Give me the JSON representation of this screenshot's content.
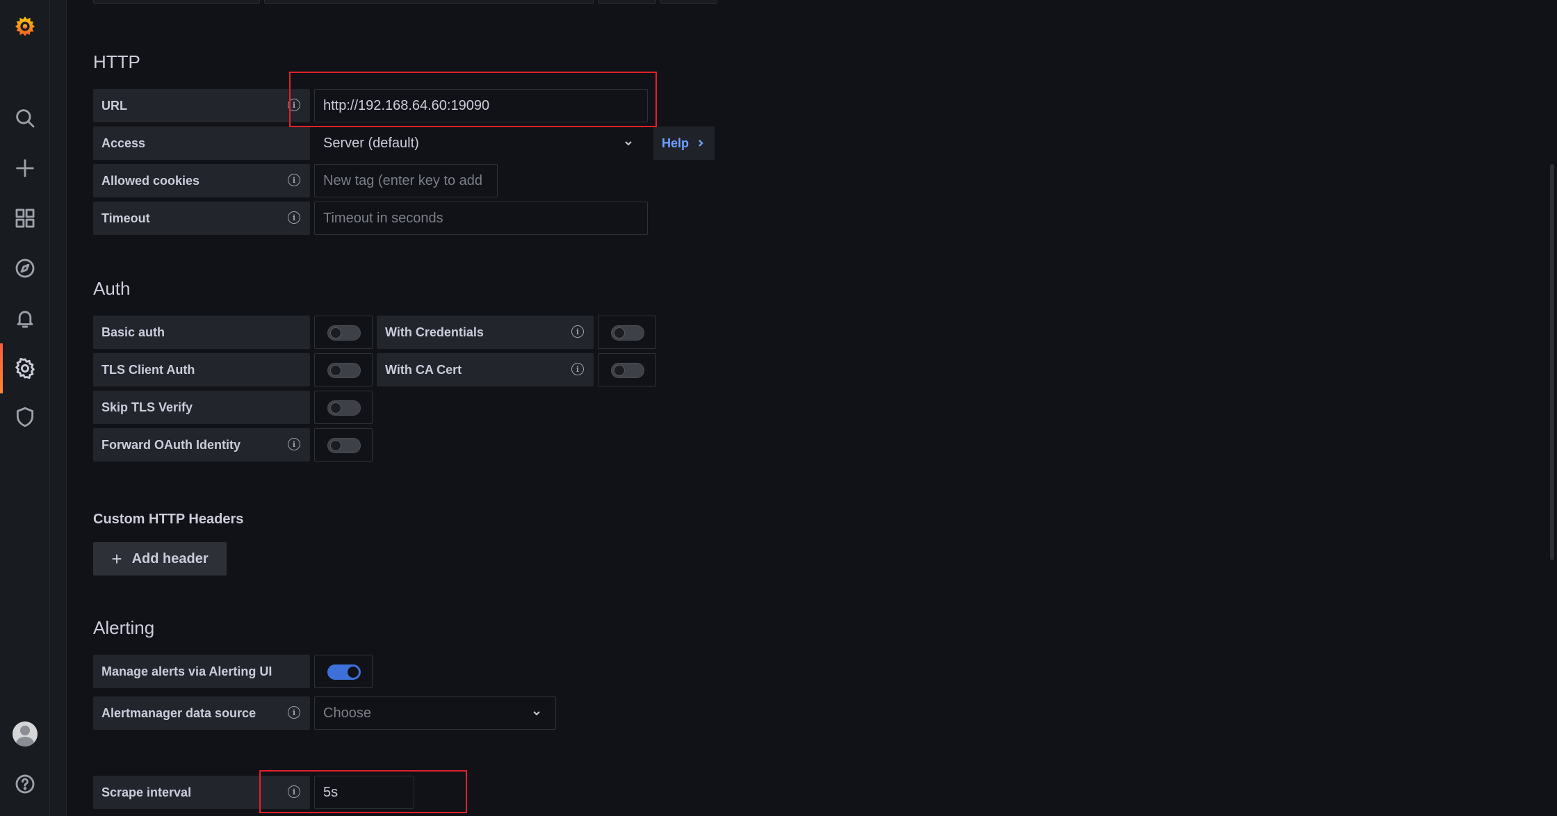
{
  "colors": {
    "accent": "#3d71d9",
    "brand": "#f55f3e",
    "link": "#6e9fff",
    "annotation": "#e3202a"
  },
  "sidebar": {
    "icons": [
      "grafana-logo-icon",
      "search-icon",
      "plus-icon",
      "dashboards-icon",
      "explore-icon",
      "alerting-icon",
      "gear-icon",
      "shield-icon",
      "avatar",
      "help-icon"
    ],
    "active": "gear-icon"
  },
  "http": {
    "title": "HTTP",
    "url_label": "URL",
    "url_value": "http://192.168.64.60:19090",
    "access_label": "Access",
    "access_value": "Server (default)",
    "help_label": "Help",
    "cookies_label": "Allowed cookies",
    "cookies_placeholder": "New tag (enter key to add",
    "timeout_label": "Timeout",
    "timeout_placeholder": "Timeout in seconds"
  },
  "auth": {
    "title": "Auth",
    "basic_auth": "Basic auth",
    "with_credentials": "With Credentials",
    "tls_client_auth": "TLS Client Auth",
    "with_ca_cert": "With CA Cert",
    "skip_tls_verify": "Skip TLS Verify",
    "forward_oauth": "Forward OAuth Identity"
  },
  "headers": {
    "title": "Custom HTTP Headers",
    "add_button": "Add header"
  },
  "alerting": {
    "title": "Alerting",
    "manage_alerts_label": "Manage alerts via Alerting UI",
    "manage_alerts_on": true,
    "alertmanager_label": "Alertmanager data source",
    "alertmanager_placeholder": "Choose"
  },
  "scrape": {
    "label": "Scrape interval",
    "value": "5s"
  }
}
